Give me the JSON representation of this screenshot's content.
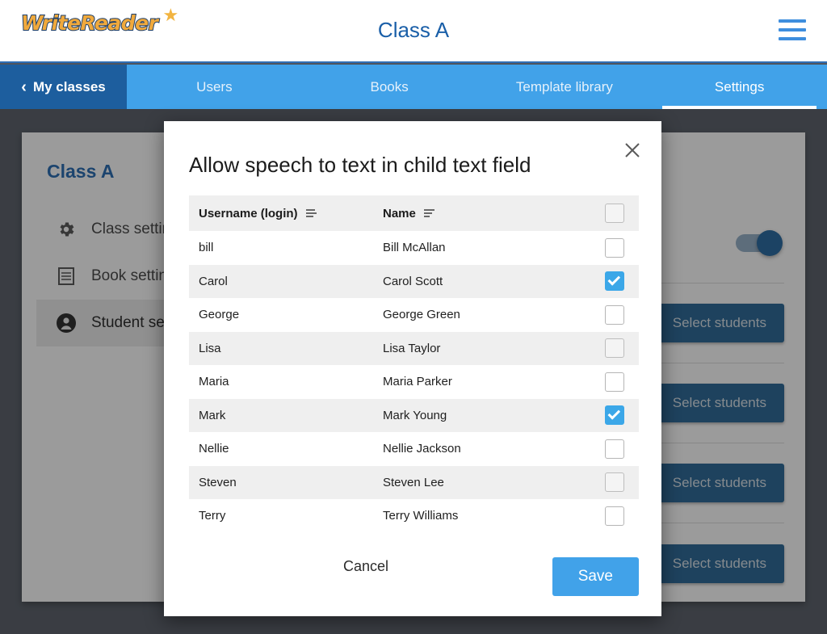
{
  "header": {
    "logo_text": "WriteReader",
    "logo_star": "★",
    "title": "Class A",
    "menu_icon": "hamburger-menu-icon"
  },
  "nav": {
    "back_label": "My classes",
    "back_chevron": "‹",
    "tabs": [
      {
        "label": "Users",
        "active": false
      },
      {
        "label": "Books",
        "active": false
      },
      {
        "label": "Template library",
        "active": false
      },
      {
        "label": "Settings",
        "active": true
      }
    ]
  },
  "page": {
    "card_title": "Class A",
    "sidebar": [
      {
        "label": "Class settings",
        "icon": "gear-icon",
        "active": false
      },
      {
        "label": "Book settings",
        "icon": "book-icon",
        "active": false
      },
      {
        "label": "Student settings",
        "icon": "person-icon",
        "active": true
      }
    ],
    "settings_rows": [
      {
        "control": "toggle",
        "toggle_on": true
      },
      {
        "control": "button",
        "button_label": "Select students"
      },
      {
        "control": "button",
        "button_label": "Select students"
      },
      {
        "control": "button",
        "button_label": "Select students"
      },
      {
        "control": "button",
        "button_label": "Select students"
      }
    ]
  },
  "modal": {
    "title": "Allow speech to text in child text field",
    "close_icon": "close-icon",
    "columns": {
      "username": "Username (login)",
      "name": "Name",
      "username_sort_icon": "sort-icon",
      "name_sort_icon": "sort-icon"
    },
    "header_checkbox": {
      "checked": false,
      "muted": true
    },
    "rows": [
      {
        "username": "bill",
        "name": "Bill McAllan",
        "checked": false,
        "muted": false
      },
      {
        "username": "Carol",
        "name": "Carol Scott",
        "checked": true,
        "muted": false
      },
      {
        "username": "George",
        "name": "George Green",
        "checked": false,
        "muted": false
      },
      {
        "username": "Lisa",
        "name": "Lisa Taylor",
        "checked": false,
        "muted": true
      },
      {
        "username": "Maria",
        "name": "Maria Parker",
        "checked": false,
        "muted": false
      },
      {
        "username": "Mark",
        "name": "Mark Young",
        "checked": true,
        "muted": false
      },
      {
        "username": "Nellie",
        "name": "Nellie Jackson",
        "checked": false,
        "muted": false
      },
      {
        "username": "Steven",
        "name": "Steven Lee",
        "checked": false,
        "muted": true
      },
      {
        "username": "Terry",
        "name": "Terry Williams",
        "checked": false,
        "muted": false
      }
    ],
    "cancel_label": "Cancel",
    "save_label": "Save"
  },
  "colors": {
    "brand_blue": "#41a2e9",
    "dark_blue": "#1d5e9e",
    "title_blue": "#1a5fa8",
    "logo_orange": "#f0a93c",
    "page_background": "#4e545e",
    "checkbox_checked": "#3ba7e8"
  }
}
